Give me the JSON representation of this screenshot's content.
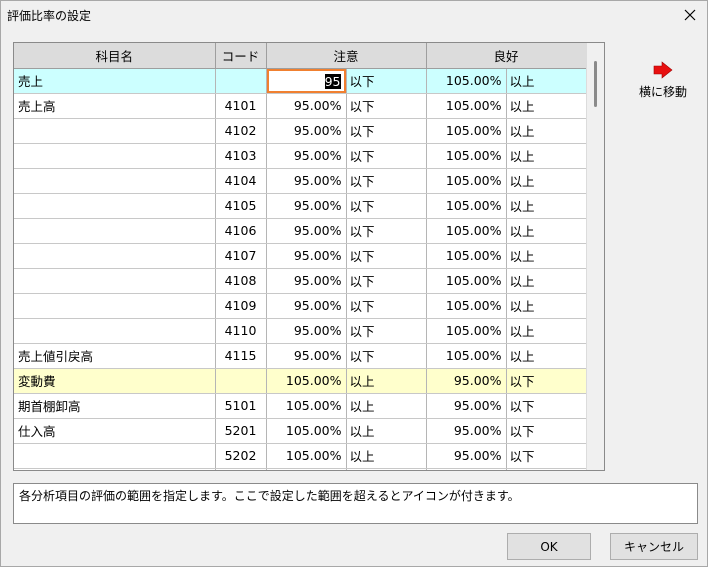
{
  "window": {
    "title": "評価比率の設定"
  },
  "grid": {
    "headers": [
      "科目名",
      "コード",
      "注意",
      "",
      "良好",
      ""
    ],
    "editing_value": "95",
    "rows": [
      {
        "name": "売上",
        "code": "",
        "caution_val": "",
        "caution_unit": "以下",
        "good_val": "105.00%",
        "good_unit": "以上",
        "highlight": "cyan",
        "editing": true
      },
      {
        "name": "売上高",
        "code": "4101",
        "caution_val": "95.00%",
        "caution_unit": "以下",
        "good_val": "105.00%",
        "good_unit": "以上"
      },
      {
        "name": "",
        "code": "4102",
        "caution_val": "95.00%",
        "caution_unit": "以下",
        "good_val": "105.00%",
        "good_unit": "以上"
      },
      {
        "name": "",
        "code": "4103",
        "caution_val": "95.00%",
        "caution_unit": "以下",
        "good_val": "105.00%",
        "good_unit": "以上"
      },
      {
        "name": "",
        "code": "4104",
        "caution_val": "95.00%",
        "caution_unit": "以下",
        "good_val": "105.00%",
        "good_unit": "以上"
      },
      {
        "name": "",
        "code": "4105",
        "caution_val": "95.00%",
        "caution_unit": "以下",
        "good_val": "105.00%",
        "good_unit": "以上"
      },
      {
        "name": "",
        "code": "4106",
        "caution_val": "95.00%",
        "caution_unit": "以下",
        "good_val": "105.00%",
        "good_unit": "以上"
      },
      {
        "name": "",
        "code": "4107",
        "caution_val": "95.00%",
        "caution_unit": "以下",
        "good_val": "105.00%",
        "good_unit": "以上"
      },
      {
        "name": "",
        "code": "4108",
        "caution_val": "95.00%",
        "caution_unit": "以下",
        "good_val": "105.00%",
        "good_unit": "以上"
      },
      {
        "name": "",
        "code": "4109",
        "caution_val": "95.00%",
        "caution_unit": "以下",
        "good_val": "105.00%",
        "good_unit": "以上"
      },
      {
        "name": "",
        "code": "4110",
        "caution_val": "95.00%",
        "caution_unit": "以下",
        "good_val": "105.00%",
        "good_unit": "以上"
      },
      {
        "name": "売上値引戻高",
        "code": "4115",
        "caution_val": "95.00%",
        "caution_unit": "以下",
        "good_val": "105.00%",
        "good_unit": "以上"
      },
      {
        "name": "変動費",
        "code": "",
        "caution_val": "105.00%",
        "caution_unit": "以上",
        "good_val": "95.00%",
        "good_unit": "以下",
        "highlight": "yellow"
      },
      {
        "name": "期首棚卸高",
        "code": "5101",
        "caution_val": "105.00%",
        "caution_unit": "以上",
        "good_val": "95.00%",
        "good_unit": "以下"
      },
      {
        "name": "仕入高",
        "code": "5201",
        "caution_val": "105.00%",
        "caution_unit": "以上",
        "good_val": "95.00%",
        "good_unit": "以下"
      },
      {
        "name": "",
        "code": "5202",
        "caution_val": "105.00%",
        "caution_unit": "以上",
        "good_val": "95.00%",
        "good_unit": "以下"
      },
      {
        "name": "",
        "code": "",
        "caution_val": "",
        "caution_unit": "",
        "good_val": "",
        "good_unit": ""
      }
    ]
  },
  "side": {
    "move_label": "横に移動",
    "arrow_color": "#e81010"
  },
  "message": "各分析項目の評価の範囲を指定します。ここで設定した範囲を超えるとアイコンが付きます。",
  "buttons": {
    "ok": "OK",
    "cancel": "キャンセル"
  },
  "colors": {
    "row_highlight_cyan": "#ccffff",
    "row_highlight_yellow": "#ffffcc",
    "edit_border": "#f08030"
  }
}
